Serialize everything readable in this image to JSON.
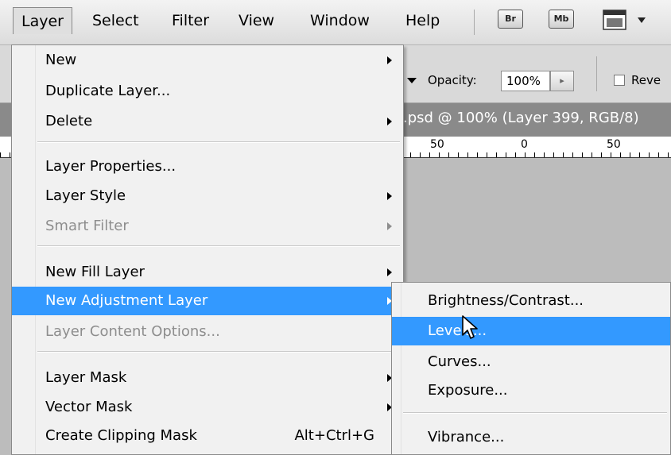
{
  "menubar": {
    "items": [
      {
        "label": "Layer",
        "active": true
      },
      {
        "label": "Select"
      },
      {
        "label": "Filter"
      },
      {
        "label": "View"
      },
      {
        "label": "Window"
      },
      {
        "label": "Help"
      }
    ],
    "bridge_label": "Br",
    "minibridge_label": "Mb"
  },
  "options_bar": {
    "opacity_label": "Opacity:",
    "opacity_value": "100%",
    "reverse_label": "Reve"
  },
  "document": {
    "tab_title": ".psd @ 100% (Layer 399, RGB/8)",
    "ruler_labels": [
      "50",
      "0",
      "50"
    ]
  },
  "layer_menu": {
    "items": {
      "new": "New",
      "duplicate": "Duplicate Layer...",
      "delete": "Delete",
      "properties": "Layer Properties...",
      "style": "Layer Style",
      "smart_filter": "Smart Filter",
      "new_fill": "New Fill Layer",
      "new_adjustment": "New Adjustment Layer",
      "content_options": "Layer Content Options...",
      "layer_mask": "Layer Mask",
      "vector_mask": "Vector Mask",
      "clipping_mask": "Create Clipping Mask",
      "clipping_shortcut": "Alt+Ctrl+G"
    }
  },
  "adjustment_submenu": {
    "items": {
      "brightness": "Brightness/Contrast...",
      "levels": "Levels...",
      "curves": "Curves...",
      "exposure": "Exposure...",
      "vibrance": "Vibrance..."
    }
  },
  "colors": {
    "highlight": "#3399ff",
    "menu_bg": "#f1f1f1",
    "disabled_text": "#8e8e8e"
  }
}
